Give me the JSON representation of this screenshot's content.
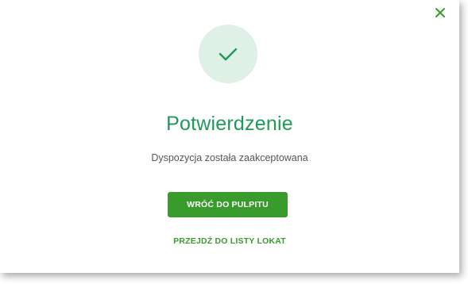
{
  "dialog": {
    "close_icon": "close-icon",
    "status_icon": "checkmark-icon",
    "title": "Potwierdzenie",
    "message": "Dyspozycja została zaakceptowana",
    "primary_button": "WRÓĆ DO PULPITU",
    "secondary_link": "PRZEJDŹ DO LISTY LOKAT"
  },
  "colors": {
    "accent_green": "#3a9b2d",
    "title_green": "#1d9a5a",
    "circle_bg": "#dff0e6",
    "text_gray": "#555555"
  }
}
